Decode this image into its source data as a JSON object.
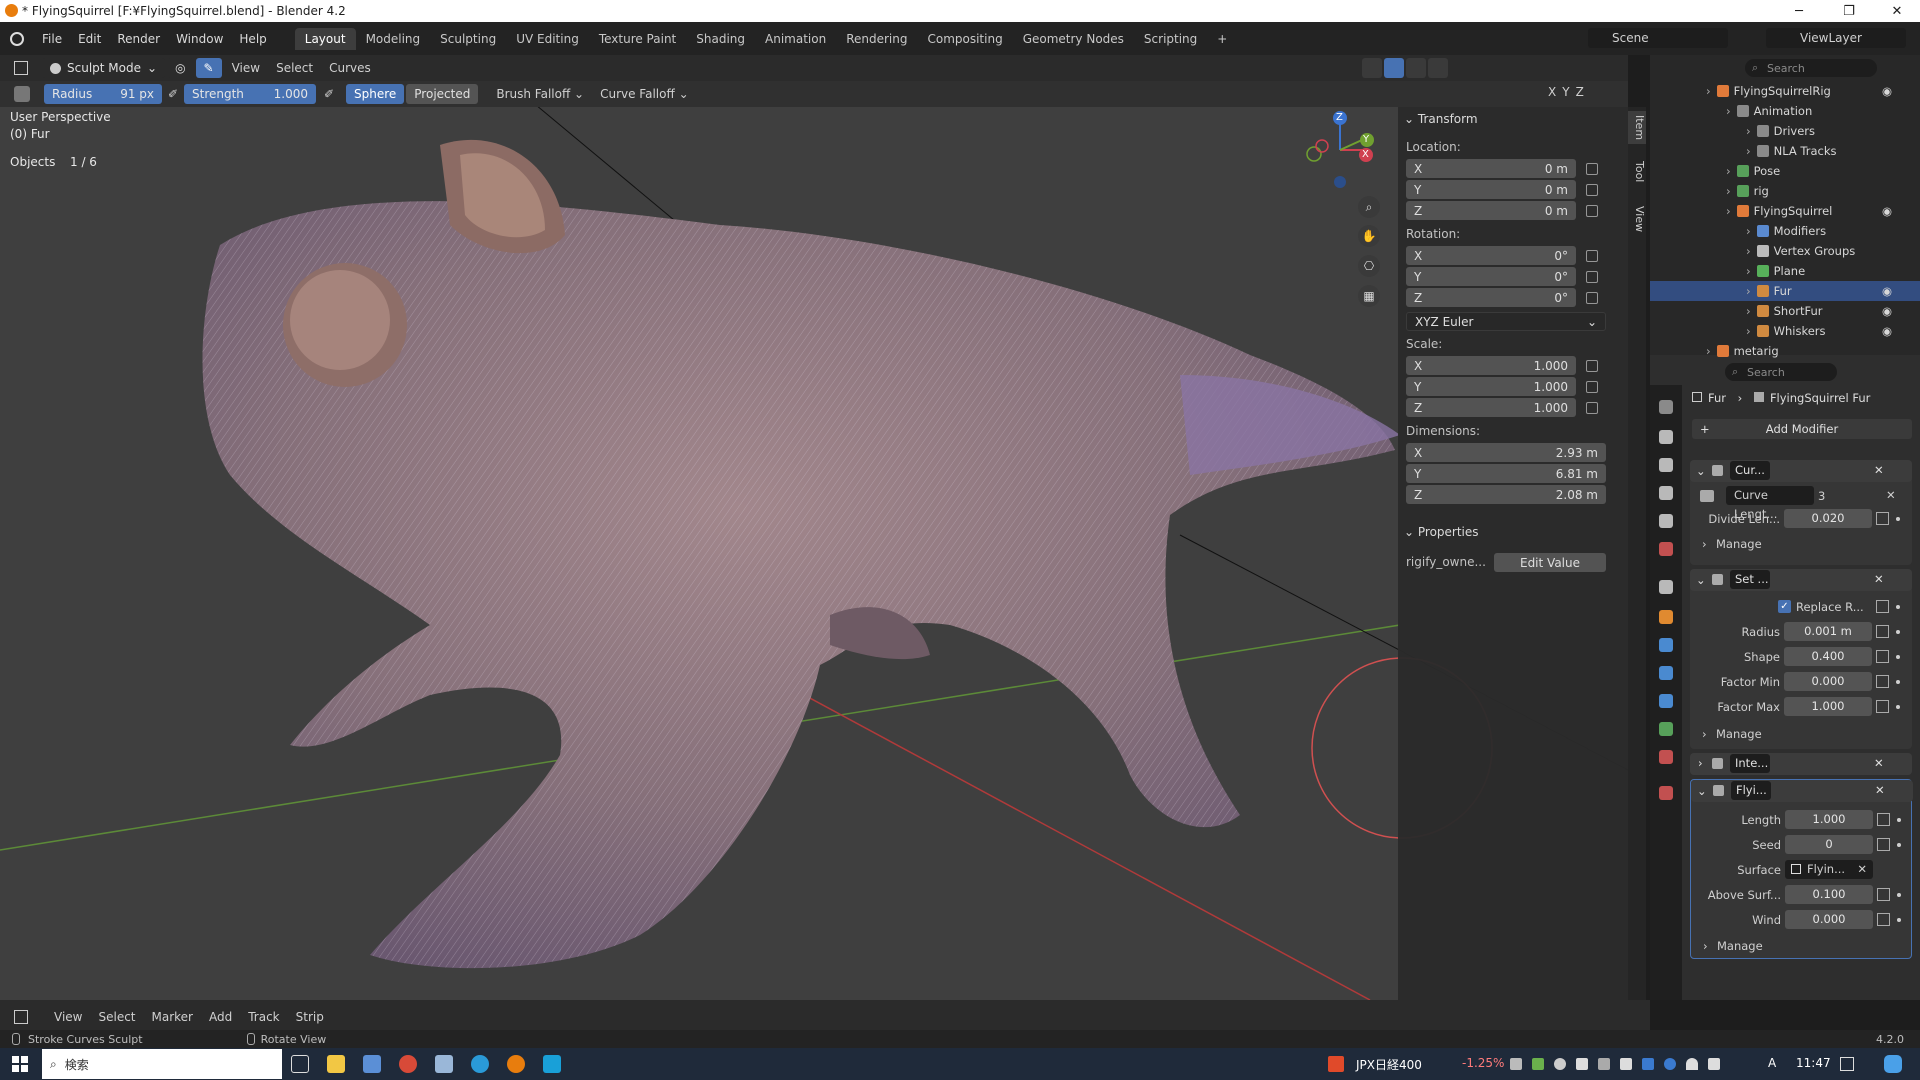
{
  "window": {
    "title": "* FlyingSquirrel [F:¥FlyingSquirrel.blend] - Blender 4.2"
  },
  "menu": [
    "File",
    "Edit",
    "Render",
    "Window",
    "Help"
  ],
  "workspaces": [
    "Layout",
    "Modeling",
    "Sculpting",
    "UV Editing",
    "Texture Paint",
    "Shading",
    "Animation",
    "Rendering",
    "Compositing",
    "Geometry Nodes",
    "Scripting"
  ],
  "active_workspace": "Layout",
  "scene": {
    "label": "Scene",
    "view_layer": "ViewLayer"
  },
  "viewport_header": {
    "mode": "Sculpt Mode",
    "menus": [
      "View",
      "Select",
      "Curves"
    ],
    "axis": [
      "X",
      "Y",
      "Z"
    ]
  },
  "tool_header": {
    "radius_label": "Radius",
    "radius_value": "91 px",
    "strength_label": "Strength",
    "strength_value": "1.000",
    "sphere": "Sphere",
    "projected": "Projected",
    "brush_falloff": "Brush Falloff",
    "curve_falloff": "Curve Falloff"
  },
  "viewport_info": {
    "perspective": "User Perspective",
    "object": "(0) Fur",
    "objects_label": "Objects",
    "objects_count": "1 / 6"
  },
  "gizmo": {
    "x": "X",
    "y": "Y",
    "z": "Z"
  },
  "npanel": {
    "tabs": [
      "Item",
      "Tool",
      "View"
    ],
    "transform": "Transform",
    "location_label": "Location:",
    "location": [
      {
        "axis": "X",
        "value": "0 m"
      },
      {
        "axis": "Y",
        "value": "0 m"
      },
      {
        "axis": "Z",
        "value": "0 m"
      }
    ],
    "rotation_label": "Rotation:",
    "rotation": [
      {
        "axis": "X",
        "value": "0°"
      },
      {
        "axis": "Y",
        "value": "0°"
      },
      {
        "axis": "Z",
        "value": "0°"
      }
    ],
    "rotation_mode": "XYZ Euler",
    "scale_label": "Scale:",
    "scale": [
      {
        "axis": "X",
        "value": "1.000"
      },
      {
        "axis": "Y",
        "value": "1.000"
      },
      {
        "axis": "Z",
        "value": "1.000"
      }
    ],
    "dimensions_label": "Dimensions:",
    "dimensions": [
      {
        "axis": "X",
        "value": "2.93 m"
      },
      {
        "axis": "Y",
        "value": "6.81 m"
      },
      {
        "axis": "Z",
        "value": "2.08 m"
      }
    ],
    "properties": "Properties",
    "prop_name": "rigify_owne...",
    "edit_value": "Edit Value"
  },
  "outliner": {
    "search_placeholder": "Search",
    "rows": [
      {
        "label": "FlyingSquirrelRig",
        "indent": 0,
        "color": "#e07a3a"
      },
      {
        "label": "Animation",
        "indent": 1,
        "color": "#8a8a8a"
      },
      {
        "label": "Drivers",
        "indent": 2,
        "color": "#8a8a8a"
      },
      {
        "label": "NLA Tracks",
        "indent": 2,
        "color": "#8a8a8a"
      },
      {
        "label": "Pose",
        "indent": 1,
        "color": "#57a05a"
      },
      {
        "label": "rig",
        "indent": 1,
        "color": "#57a05a"
      },
      {
        "label": "FlyingSquirrel",
        "indent": 1,
        "color": "#e07a3a"
      },
      {
        "label": "Modifiers",
        "indent": 2,
        "color": "#5a8ad0"
      },
      {
        "label": "Vertex Groups",
        "indent": 2,
        "color": "#bbbbbb"
      },
      {
        "label": "Plane",
        "indent": 2,
        "color": "#57b05a"
      },
      {
        "label": "Fur",
        "indent": 2,
        "color": "#d08a40"
      },
      {
        "label": "ShortFur",
        "indent": 2,
        "color": "#d08a40"
      },
      {
        "label": "Whiskers",
        "indent": 2,
        "color": "#d08a40"
      },
      {
        "label": "metarig",
        "indent": 0,
        "color": "#e07a3a"
      }
    ]
  },
  "properties": {
    "search_placeholder": "Search",
    "breadcrumb_object": "Fur",
    "breadcrumb_data": "FlyingSquirrel Fur",
    "add_modifier": "Add Modifier",
    "mod1": {
      "name": "Cur...",
      "node_group": "Curve Lengt...",
      "users": "3",
      "divide_label": "Divide Len...",
      "divide_value": "0.020",
      "manage": "Manage"
    },
    "mod2": {
      "name": "Set ...",
      "replace_label": "Replace R...",
      "radius_label": "Radius",
      "radius_value": "0.001 m",
      "shape_label": "Shape",
      "shape_value": "0.400",
      "fmin_label": "Factor Min",
      "fmin_value": "0.000",
      "fmax_label": "Factor Max",
      "fmax_value": "1.000",
      "manage": "Manage"
    },
    "mod3": {
      "name": "Inte..."
    },
    "mod4": {
      "name": "Flyi...",
      "length_label": "Length",
      "length_value": "1.000",
      "seed_label": "Seed",
      "seed_value": "0",
      "surface_label": "Surface",
      "surface_value": "Flyin...",
      "above_label": "Above Surf...",
      "above_value": "0.100",
      "wind_label": "Wind",
      "wind_value": "0.000",
      "manage": "Manage"
    }
  },
  "timeline": {
    "menus": [
      "View",
      "Select",
      "Marker",
      "Add",
      "Track",
      "Strip"
    ]
  },
  "status": {
    "left": "Stroke Curves Sculpt",
    "mid": "Rotate View",
    "version": "4.2.0"
  },
  "taskbar": {
    "search": "検索",
    "stock": "JPX日経400",
    "stock_change": "-1.25%",
    "time": "11:47",
    "ime": "A"
  }
}
